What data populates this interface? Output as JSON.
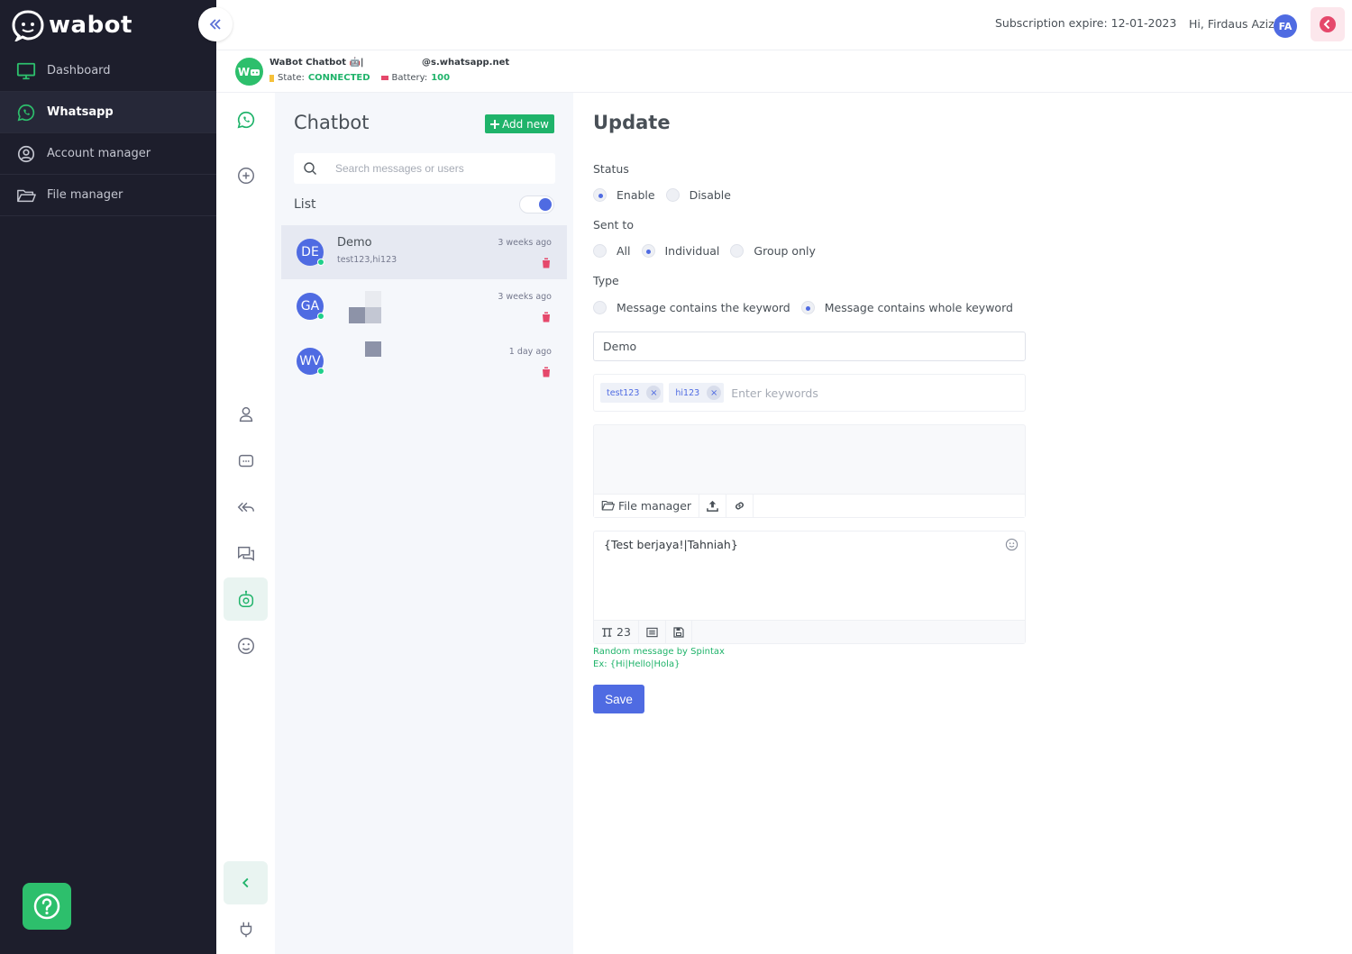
{
  "brand": {
    "logo_text": "wabot"
  },
  "sidebar": {
    "items": [
      {
        "label": "Dashboard",
        "icon": "monitor-icon"
      },
      {
        "label": "Whatsapp",
        "icon": "whatsapp-icon",
        "active": true
      },
      {
        "label": "Account manager",
        "icon": "user-circle-icon"
      },
      {
        "label": "File manager",
        "icon": "folder-open-icon"
      }
    ]
  },
  "header": {
    "subscription": "Subscription expire: 12-01-2023",
    "greeting": "Hi, Firdaus Azizi",
    "user_initials": "FA"
  },
  "account": {
    "avatar_initials": "W",
    "name": "WaBot Chatbot 🤖|",
    "domain": "@s.whatsapp.net",
    "state_label": "State:",
    "state_value": "CONNECTED",
    "battery_label": "Battery:",
    "battery_value": "100"
  },
  "list_panel": {
    "title": "Chatbot",
    "add_button": "Add new",
    "search_placeholder": "Search messages or users",
    "list_label": "List",
    "toggle_on": true,
    "items": [
      {
        "initials": "DE",
        "name": "Demo",
        "keywords": "test123,hi123",
        "time": "3 weeks ago",
        "active": true
      },
      {
        "initials": "GA",
        "name": "",
        "keywords": "",
        "time": "3 weeks ago"
      },
      {
        "initials": "WV",
        "name": "",
        "keywords": "",
        "time": "1 day ago"
      }
    ]
  },
  "form": {
    "title": "Update",
    "status_label": "Status",
    "status_options": [
      "Enable",
      "Disable"
    ],
    "status_selected": "Enable",
    "sent_to_label": "Sent to",
    "sent_to_options": [
      "All",
      "Individual",
      "Group only"
    ],
    "sent_to_selected": "Individual",
    "type_label": "Type",
    "type_options": [
      "Message contains the keyword",
      "Message contains whole keyword"
    ],
    "type_selected": "Message contains whole keyword",
    "name_value": "Demo",
    "keywords": [
      "test123",
      "hi123"
    ],
    "keywords_placeholder": "Enter keywords",
    "file_manager_label": "File manager",
    "message": "{Test berjaya!|Tahniah}",
    "spintax_count": "23",
    "spintax_hint": "Random message by Spintax",
    "spintax_example": "Ex: {Hi|Hello|Hola}",
    "save_label": "Save"
  },
  "colors": {
    "accent": "#4f6be2",
    "success": "#1fb36a",
    "sidebar_bg": "#1d1e2c",
    "danger": "#e5486b"
  }
}
